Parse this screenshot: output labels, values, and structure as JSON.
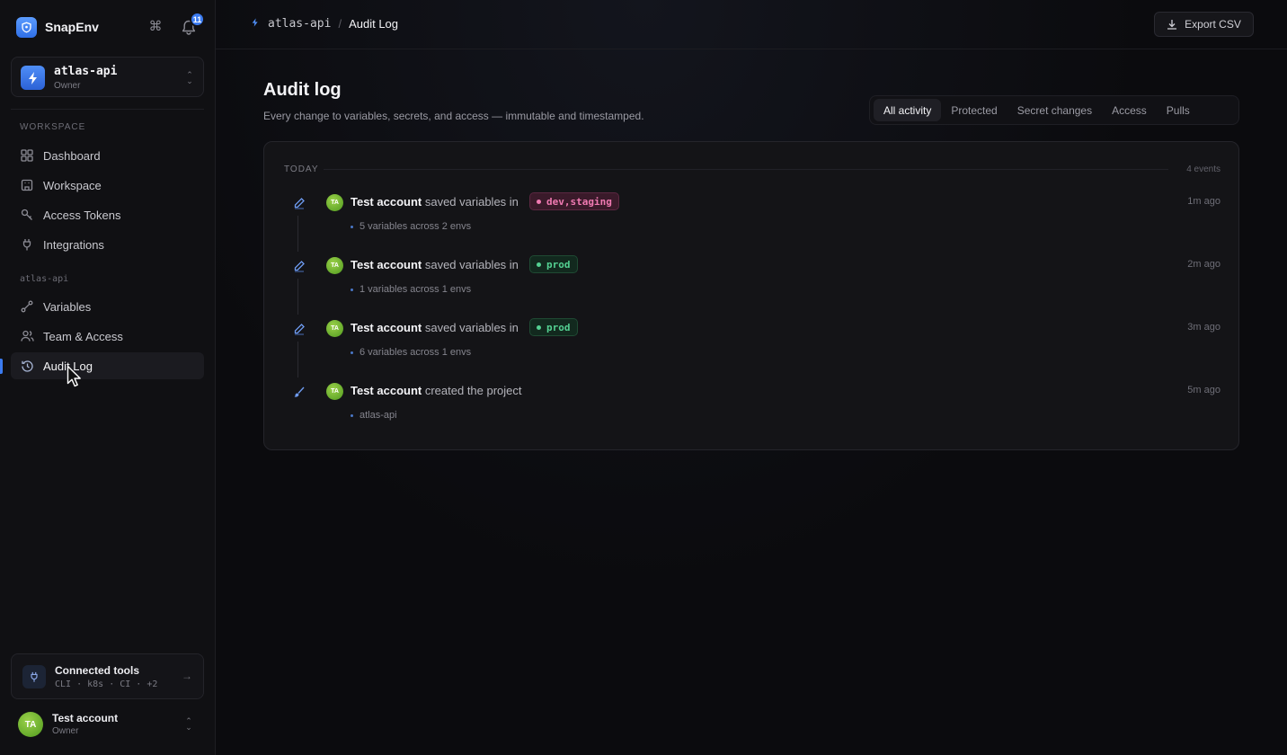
{
  "sidebar": {
    "brand": "SnapEnv",
    "notifications_count": "11",
    "project": {
      "name": "atlas-api",
      "role": "Owner"
    },
    "workspace_label": "WORKSPACE",
    "workspace_items": [
      {
        "label": "Dashboard",
        "icon": "grid-icon"
      },
      {
        "label": "Workspace",
        "icon": "building-icon"
      },
      {
        "label": "Access Tokens",
        "icon": "key-icon"
      },
      {
        "label": "Integrations",
        "icon": "plug-icon"
      }
    ],
    "project_label": "atlas-api",
    "project_items": [
      {
        "label": "Variables",
        "icon": "variables-icon"
      },
      {
        "label": "Team & Access",
        "icon": "users-icon"
      },
      {
        "label": "Audit Log",
        "icon": "history-icon",
        "active": true
      }
    ],
    "connected_tools": {
      "title": "Connected tools",
      "subtitle": "CLI · k8s · CI · +2"
    },
    "user": {
      "initials": "TA",
      "name": "Test account",
      "role": "Owner"
    }
  },
  "header": {
    "breadcrumb_project": "atlas-api",
    "breadcrumb_separator": "/",
    "breadcrumb_current": "Audit Log",
    "export_label": "Export CSV"
  },
  "page": {
    "title": "Audit log",
    "subtitle": "Every change to variables, secrets, and access — immutable and timestamped.",
    "filters": [
      "All activity",
      "Protected",
      "Secret changes",
      "Access",
      "Pulls"
    ],
    "active_filter": "All activity"
  },
  "timeline": {
    "group_label": "TODAY",
    "event_count": "4 events",
    "events": [
      {
        "initials": "TA",
        "actor": "Test account",
        "action": "saved variables in",
        "tag": "dev,staging",
        "tag_color": "#f07ab2",
        "detail": "5 variables across 2 envs",
        "time": "1m ago"
      },
      {
        "initials": "TA",
        "actor": "Test account",
        "action": "saved variables in",
        "tag": "prod",
        "tag_color": "#54d192",
        "detail": "1 variables across 1 envs",
        "time": "2m ago"
      },
      {
        "initials": "TA",
        "actor": "Test account",
        "action": "saved variables in",
        "tag": "prod",
        "tag_color": "#54d192",
        "detail": "6 variables across 1 envs",
        "time": "3m ago"
      },
      {
        "initials": "TA",
        "actor": "Test account",
        "action": "created the project",
        "tag": "",
        "detail": "atlas-api",
        "time": "5m ago"
      }
    ]
  },
  "colors": {
    "accent": "#3b7bf0",
    "prod": "#54d192",
    "staging": "#f07ab2"
  }
}
